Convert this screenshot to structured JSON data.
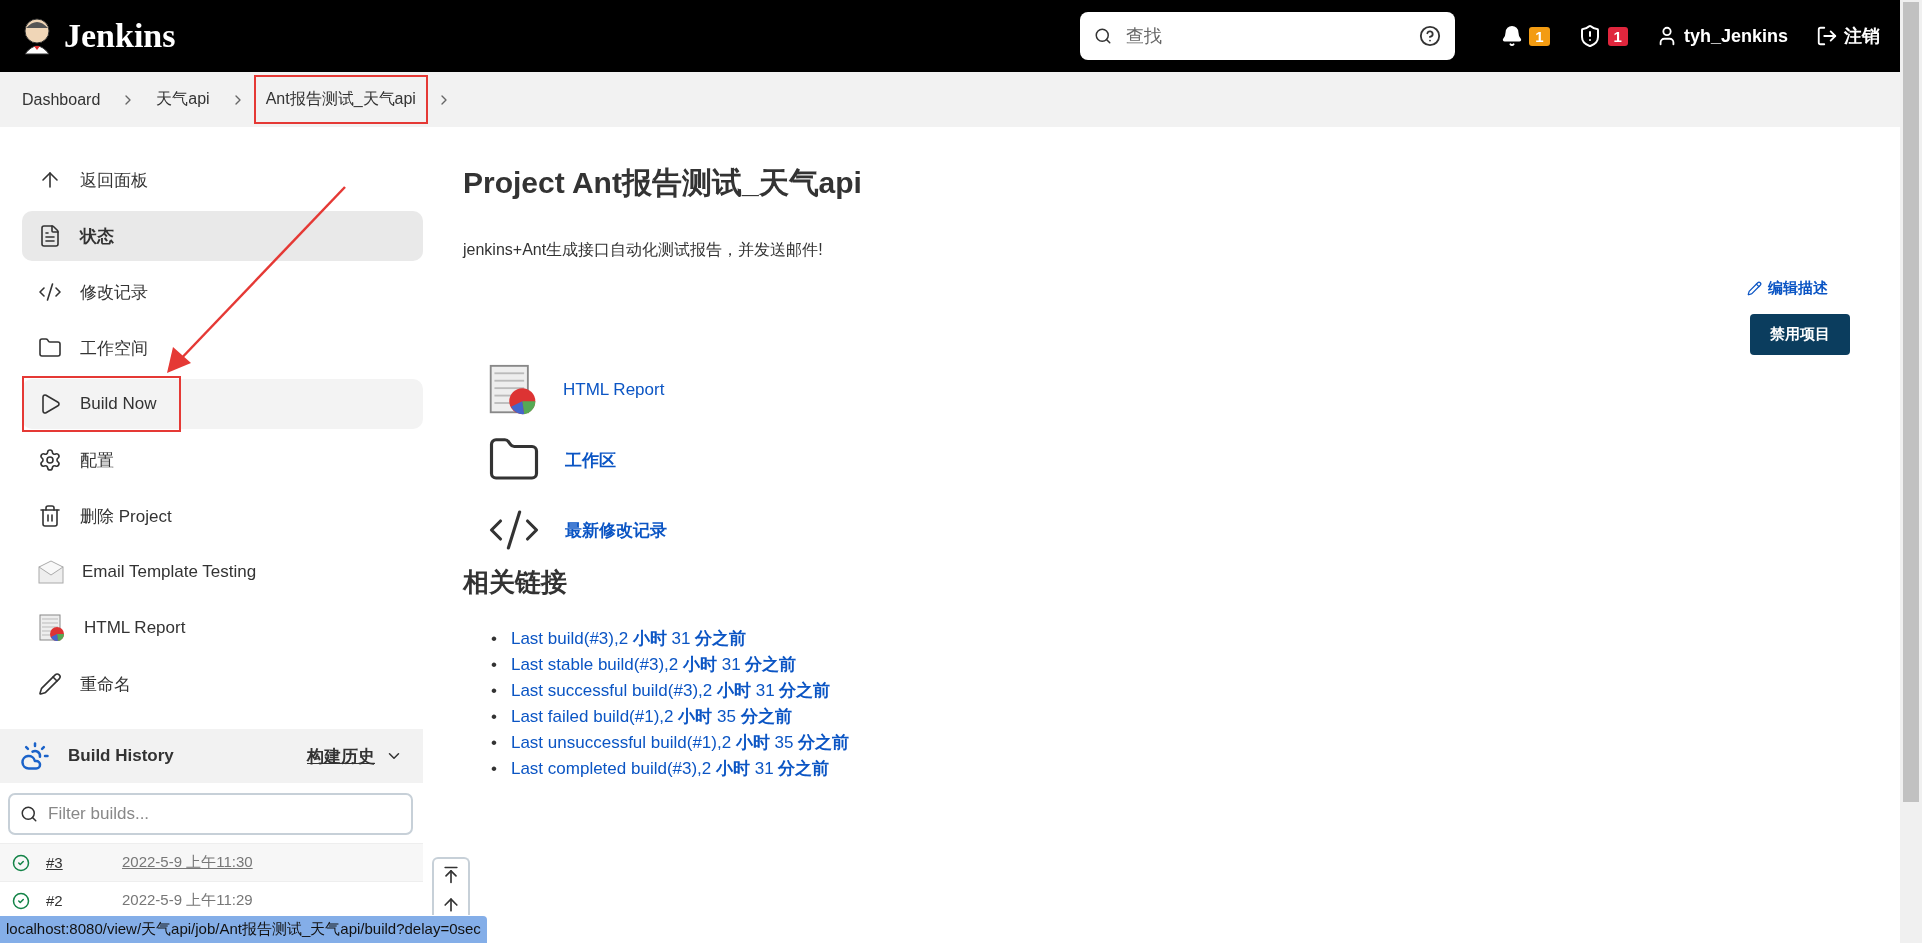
{
  "header": {
    "logo": "Jenkins",
    "search": {
      "placeholder": "查找"
    },
    "notifications": "1",
    "security": "1",
    "user": "tyh_Jenkins",
    "logout": "注销"
  },
  "breadcrumb": [
    {
      "label": "Dashboard",
      "annotated": false
    },
    {
      "label": "天气api",
      "annotated": false
    },
    {
      "label": "Ant报告测试_天气api",
      "annotated": true
    }
  ],
  "sidebar": {
    "items": [
      {
        "label": "返回面板",
        "selected": false,
        "hovered": false,
        "annotated": false
      },
      {
        "label": "状态",
        "selected": true,
        "hovered": false,
        "annotated": false
      },
      {
        "label": "修改记录",
        "selected": false,
        "hovered": false,
        "annotated": false
      },
      {
        "label": "工作空间",
        "selected": false,
        "hovered": false,
        "annotated": false
      },
      {
        "label": "Build Now",
        "selected": false,
        "hovered": true,
        "annotated": true
      },
      {
        "label": "配置",
        "selected": false,
        "hovered": false,
        "annotated": false
      },
      {
        "label": "删除 Project",
        "selected": false,
        "hovered": false,
        "annotated": false
      },
      {
        "label": "Email Template Testing",
        "selected": false,
        "hovered": false,
        "annotated": false
      },
      {
        "label": "HTML Report",
        "selected": false,
        "hovered": false,
        "annotated": false
      },
      {
        "label": "重命名",
        "selected": false,
        "hovered": false,
        "annotated": false
      }
    ]
  },
  "build_history": {
    "title": "Build History",
    "link": "构建历史",
    "filter": {
      "placeholder": "Filter builds..."
    },
    "builds": [
      {
        "number": "#3",
        "date": "2022-5-9 上午11:30",
        "hovered": true
      },
      {
        "number": "#2",
        "date": "2022-5-9 上午11:29",
        "hovered": false
      }
    ]
  },
  "main": {
    "title": "Project Ant报告测试_天气api",
    "description": "jenkins+Ant生成接口自动化测试报告，并发送邮件!",
    "edit_description": "编辑描述",
    "disable_button": "禁用项目",
    "actions": [
      "HTML Report",
      "工作区",
      "最新修改记录"
    ],
    "related_title": "相关链接",
    "related_links": [
      {
        "marker": "•",
        "text": "Last build(#3),2 **小时** 31 **分之前**"
      },
      {
        "marker": "•",
        "text": "Last stable build(#3),2 **小时** 31 **分之前**"
      },
      {
        "marker": "•",
        "text": "Last successful build(#3),2 **小时** 31 **分之前**"
      },
      {
        "marker": "•",
        "text": "Last failed build(#1),2 **小时** 35 **分之前**"
      },
      {
        "marker": "•",
        "text": "Last unsuccessful build(#1),2 **小时** 35 **分之前**"
      },
      {
        "marker": "•",
        "text": "Last completed build(#3),2 **小时** 31 **分之前**"
      }
    ]
  },
  "status_bar": "localhost:8080/view/天气api/job/Ant报告测试_天气api/build?delay=0sec"
}
